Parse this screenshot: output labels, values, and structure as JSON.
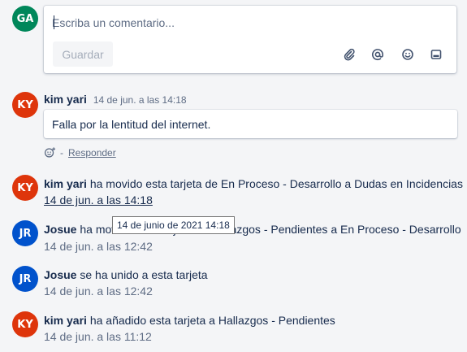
{
  "composer": {
    "avatar_initials": "GA",
    "avatar_color": "#00875a",
    "placeholder": "Escriba un comentario...",
    "save_label": "Guardar",
    "icons": [
      "attachment-icon",
      "mention-icon",
      "emoji-icon",
      "card-icon"
    ]
  },
  "comment": {
    "avatar_initials": "KY",
    "avatar_color": "#de350b",
    "author": "kim yari",
    "time": "14 de jun. a las 14:18",
    "text": "Falla por la lentitud del internet.",
    "reply_label": "Responder",
    "separator": "-"
  },
  "activities": [
    {
      "avatar_initials": "KY",
      "avatar_color": "#de350b",
      "author": "kim yari",
      "text": "ha movido esta tarjeta de En Proceso - Desarrollo a Dudas en Incidencias",
      "time": "14 de jun. a las 14:18"
    },
    {
      "avatar_initials": "JR",
      "avatar_color": "#0052cc",
      "author": "Josue",
      "text": "ha movido esta tarjeta de Hallazgos - Pendientes a En Proceso - Desarrollo",
      "time": "14 de jun. a las 12:42"
    },
    {
      "avatar_initials": "JR",
      "avatar_color": "#0052cc",
      "author": "Josue",
      "text": "se ha unido a esta tarjeta",
      "time": "14 de jun. a las 12:42"
    },
    {
      "avatar_initials": "KY",
      "avatar_color": "#de350b",
      "author": "kim yari",
      "text": "ha añadido esta tarjeta a Hallazgos - Pendientes",
      "time": "14 de jun. a las 11:12"
    }
  ],
  "tooltip": "14 de junio de 2021 14:18"
}
